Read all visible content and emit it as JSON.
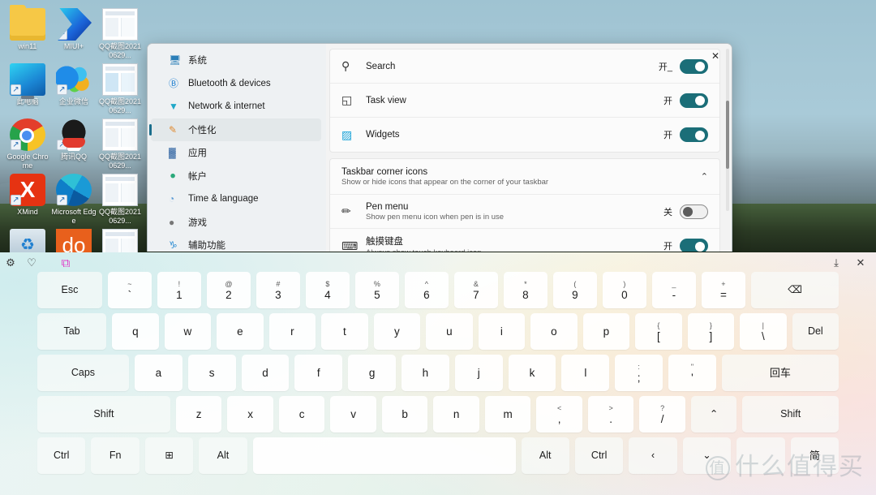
{
  "desktop": {
    "icons": [
      {
        "label": "win11",
        "icon": "folder-icon",
        "shortcut": false
      },
      {
        "label": "MIUI+",
        "icon": "miui-icon",
        "shortcut": true
      },
      {
        "label": "QQ截图20210629...",
        "icon": "screenshot-icon",
        "shortcut": false
      },
      {
        "label": "此电脑",
        "icon": "this-pc-icon",
        "shortcut": true
      },
      {
        "label": "企业微信",
        "icon": "wecom-icon",
        "shortcut": true
      },
      {
        "label": "QQ截图20210629...",
        "icon": "screenshot-icon",
        "shortcut": false
      },
      {
        "label": "Google Chrome",
        "icon": "chrome-icon",
        "shortcut": true
      },
      {
        "label": "腾讯QQ",
        "icon": "qq-icon",
        "shortcut": true
      },
      {
        "label": "QQ截图20210629...",
        "icon": "screenshot-icon",
        "shortcut": false
      },
      {
        "label": "XMind",
        "icon": "xmind-icon",
        "shortcut": true
      },
      {
        "label": "Microsoft Edge",
        "icon": "edge-icon",
        "shortcut": true
      },
      {
        "label": "QQ截图20210629...",
        "icon": "screenshot-icon",
        "shortcut": false
      },
      {
        "label": "",
        "icon": "recycle-bin-icon",
        "shortcut": false
      },
      {
        "label": "",
        "icon": "doc-icon",
        "shortcut": false
      },
      {
        "label": "",
        "icon": "screenshot-icon",
        "shortcut": false
      }
    ]
  },
  "settings": {
    "close_label": "✕",
    "nav": [
      {
        "label": "系统",
        "icon": "system-icon",
        "selected": false
      },
      {
        "label": "Bluetooth & devices",
        "icon": "bluetooth-icon",
        "selected": false
      },
      {
        "label": "Network & internet",
        "icon": "network-icon",
        "selected": false
      },
      {
        "label": "个性化",
        "icon": "personalization-icon",
        "selected": true
      },
      {
        "label": "应用",
        "icon": "apps-icon",
        "selected": false
      },
      {
        "label": "帐户",
        "icon": "accounts-icon",
        "selected": false
      },
      {
        "label": "Time & language",
        "icon": "time-language-icon",
        "selected": false
      },
      {
        "label": "游戏",
        "icon": "gaming-icon",
        "selected": false
      },
      {
        "label": "辅助功能",
        "icon": "accessibility-icon",
        "selected": false
      }
    ],
    "rows": [
      {
        "title": "Search",
        "sub": "",
        "icon": "search-icon",
        "state": "开_",
        "on": true
      },
      {
        "title": "Task view",
        "sub": "",
        "icon": "task-view-icon",
        "state": "开",
        "on": true
      },
      {
        "title": "Widgets",
        "sub": "",
        "icon": "widgets-icon",
        "state": "开",
        "on": true
      }
    ],
    "section": {
      "title": "Taskbar corner icons",
      "sub": "Show or hide icons that appear on the corner of your taskbar",
      "chevron": "⌃"
    },
    "section_rows": [
      {
        "title": "Pen menu",
        "sub": "Show pen menu icon when pen is in use",
        "icon": "pen-icon",
        "state": "关",
        "on": false
      },
      {
        "title": "触摸键盘",
        "sub": "Always show touch keyboard icon",
        "icon": "touch-keyboard-icon",
        "state": "开",
        "on": true
      }
    ]
  },
  "keyboard": {
    "toolbar": [
      {
        "name": "settings-gear-icon",
        "glyph": "⚙",
        "color": "#3a3a3a"
      },
      {
        "name": "favorites-icon",
        "glyph": "♡",
        "color": "#2a2a2a"
      },
      {
        "name": "clipboard-icon",
        "glyph": "⧉",
        "color": "#e040c8"
      }
    ],
    "dock_icon": "⤓",
    "close_icon": "✕",
    "rows": [
      [
        {
          "main": "Esc",
          "sup": "",
          "flex": 1.48,
          "type": "mod",
          "name": "key-esc"
        },
        {
          "main": "`",
          "sup": "~",
          "flex": 1,
          "type": "dual",
          "name": "key-backtick"
        },
        {
          "main": "1",
          "sup": "!",
          "flex": 1,
          "type": "dual",
          "name": "key-1"
        },
        {
          "main": "2",
          "sup": "@",
          "flex": 1,
          "type": "dual",
          "name": "key-2"
        },
        {
          "main": "3",
          "sup": "#",
          "flex": 1,
          "type": "dual",
          "name": "key-3"
        },
        {
          "main": "4",
          "sup": "$",
          "flex": 1,
          "type": "dual",
          "name": "key-4"
        },
        {
          "main": "5",
          "sup": "%",
          "flex": 1,
          "type": "dual",
          "name": "key-5"
        },
        {
          "main": "6",
          "sup": "^",
          "flex": 1,
          "type": "dual",
          "name": "key-6"
        },
        {
          "main": "7",
          "sup": "&",
          "flex": 1,
          "type": "dual",
          "name": "key-7"
        },
        {
          "main": "8",
          "sup": "*",
          "flex": 1,
          "type": "dual",
          "name": "key-8"
        },
        {
          "main": "9",
          "sup": "(",
          "flex": 1,
          "type": "dual",
          "name": "key-9"
        },
        {
          "main": "0",
          "sup": ")",
          "flex": 1,
          "type": "dual",
          "name": "key-0"
        },
        {
          "main": "-",
          "sup": "_",
          "flex": 1,
          "type": "dual",
          "name": "key-minus"
        },
        {
          "main": "=",
          "sup": "+",
          "flex": 1,
          "type": "dual",
          "name": "key-equals"
        },
        {
          "main": "⌫",
          "sup": "",
          "flex": 2.0,
          "type": "mod",
          "name": "key-backspace"
        }
      ],
      [
        {
          "main": "Tab",
          "sup": "",
          "flex": 1.48,
          "type": "mod",
          "name": "key-tab"
        },
        {
          "main": "q",
          "sup": "",
          "flex": 1,
          "type": "",
          "name": "key-q"
        },
        {
          "main": "w",
          "sup": "",
          "flex": 1,
          "type": "",
          "name": "key-w"
        },
        {
          "main": "e",
          "sup": "",
          "flex": 1,
          "type": "",
          "name": "key-e"
        },
        {
          "main": "r",
          "sup": "",
          "flex": 1,
          "type": "",
          "name": "key-r"
        },
        {
          "main": "t",
          "sup": "",
          "flex": 1,
          "type": "",
          "name": "key-t"
        },
        {
          "main": "y",
          "sup": "",
          "flex": 1,
          "type": "",
          "name": "key-y"
        },
        {
          "main": "u",
          "sup": "",
          "flex": 1,
          "type": "",
          "name": "key-u"
        },
        {
          "main": "i",
          "sup": "",
          "flex": 1,
          "type": "",
          "name": "key-i"
        },
        {
          "main": "o",
          "sup": "",
          "flex": 1,
          "type": "",
          "name": "key-o"
        },
        {
          "main": "p",
          "sup": "",
          "flex": 1,
          "type": "",
          "name": "key-p"
        },
        {
          "main": "[",
          "sup": "{",
          "flex": 1,
          "type": "dual",
          "name": "key-bracket-left"
        },
        {
          "main": "]",
          "sup": "}",
          "flex": 1,
          "type": "dual",
          "name": "key-bracket-right"
        },
        {
          "main": "\\",
          "sup": "|",
          "flex": 1,
          "type": "dual",
          "name": "key-backslash"
        },
        {
          "main": "Del",
          "sup": "",
          "flex": 1.0,
          "type": "mod",
          "name": "key-delete"
        }
      ],
      [
        {
          "main": "Caps",
          "sup": "",
          "flex": 1.92,
          "type": "mod",
          "name": "key-capslock"
        },
        {
          "main": "a",
          "sup": "",
          "flex": 1,
          "type": "",
          "name": "key-a"
        },
        {
          "main": "s",
          "sup": "",
          "flex": 1,
          "type": "",
          "name": "key-s"
        },
        {
          "main": "d",
          "sup": "",
          "flex": 1,
          "type": "",
          "name": "key-d"
        },
        {
          "main": "f",
          "sup": "",
          "flex": 1,
          "type": "",
          "name": "key-f"
        },
        {
          "main": "g",
          "sup": "",
          "flex": 1,
          "type": "",
          "name": "key-g"
        },
        {
          "main": "h",
          "sup": "",
          "flex": 1,
          "type": "",
          "name": "key-h"
        },
        {
          "main": "j",
          "sup": "",
          "flex": 1,
          "type": "",
          "name": "key-j"
        },
        {
          "main": "k",
          "sup": "",
          "flex": 1,
          "type": "",
          "name": "key-k"
        },
        {
          "main": "l",
          "sup": "",
          "flex": 1,
          "type": "",
          "name": "key-l"
        },
        {
          "main": ";",
          "sup": ":",
          "flex": 1,
          "type": "dual",
          "name": "key-semicolon"
        },
        {
          "main": "'",
          "sup": "\"",
          "flex": 1,
          "type": "dual",
          "name": "key-quote"
        },
        {
          "main": "回车",
          "sup": "",
          "flex": 2.45,
          "type": "mod cn",
          "name": "key-enter"
        }
      ],
      [
        {
          "main": "Shift",
          "sup": "",
          "flex": 2.9,
          "type": "mod",
          "name": "key-shift-left"
        },
        {
          "main": "z",
          "sup": "",
          "flex": 1,
          "type": "",
          "name": "key-z"
        },
        {
          "main": "x",
          "sup": "",
          "flex": 1,
          "type": "",
          "name": "key-x"
        },
        {
          "main": "c",
          "sup": "",
          "flex": 1,
          "type": "",
          "name": "key-c"
        },
        {
          "main": "v",
          "sup": "",
          "flex": 1,
          "type": "",
          "name": "key-v"
        },
        {
          "main": "b",
          "sup": "",
          "flex": 1,
          "type": "",
          "name": "key-b"
        },
        {
          "main": "n",
          "sup": "",
          "flex": 1,
          "type": "",
          "name": "key-n"
        },
        {
          "main": "m",
          "sup": "",
          "flex": 1,
          "type": "",
          "name": "key-m"
        },
        {
          "main": ",",
          "sup": "<",
          "flex": 1,
          "type": "dual",
          "name": "key-comma"
        },
        {
          "main": ".",
          "sup": ">",
          "flex": 1,
          "type": "dual",
          "name": "key-period"
        },
        {
          "main": "/",
          "sup": "?",
          "flex": 1,
          "type": "dual",
          "name": "key-slash"
        },
        {
          "main": "⌃",
          "sup": "",
          "flex": 1,
          "type": "mod",
          "name": "key-arrow-up"
        },
        {
          "main": "Shift",
          "sup": "",
          "flex": 2.1,
          "type": "mod",
          "name": "key-shift-right"
        }
      ],
      [
        {
          "main": "Ctrl",
          "sup": "",
          "flex": 1,
          "type": "mod",
          "name": "key-ctrl-left"
        },
        {
          "main": "Fn",
          "sup": "",
          "flex": 1,
          "type": "mod",
          "name": "key-fn"
        },
        {
          "main": "⊞",
          "sup": "",
          "flex": 1,
          "type": "mod",
          "name": "key-windows"
        },
        {
          "main": "Alt",
          "sup": "",
          "flex": 1,
          "type": "mod",
          "name": "key-alt-left"
        },
        {
          "main": "",
          "sup": "",
          "flex": 5.45,
          "type": "",
          "name": "key-space"
        },
        {
          "main": "Alt",
          "sup": "",
          "flex": 1,
          "type": "mod",
          "name": "key-alt-right"
        },
        {
          "main": "Ctrl",
          "sup": "",
          "flex": 1,
          "type": "mod",
          "name": "key-ctrl-right"
        },
        {
          "main": "‹",
          "sup": "",
          "flex": 1,
          "type": "mod",
          "name": "key-arrow-left"
        },
        {
          "main": "⌄",
          "sup": "",
          "flex": 1,
          "type": "mod",
          "name": "key-arrow-down"
        },
        {
          "main": "",
          "sup": "",
          "flex": 1,
          "type": "mod",
          "name": "key-blank"
        },
        {
          "main": "简",
          "sup": "",
          "flex": 1,
          "type": "mod cn",
          "name": "key-ime-simplified"
        }
      ]
    ],
    "watermark": "什么值得买",
    "watermark_mark": "值"
  },
  "colors": {
    "toggle_on": "#1b6e78",
    "accent": "#1b6e8c"
  }
}
